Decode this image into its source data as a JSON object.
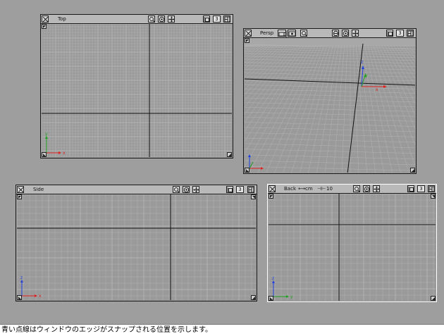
{
  "viewports": {
    "top": {
      "label": "Top",
      "axes": [
        "x",
        "y"
      ],
      "count": "3"
    },
    "persp": {
      "label": "Persp",
      "axes": [
        "x",
        "y",
        "z"
      ],
      "count": "3"
    },
    "side": {
      "label": "Side",
      "axes": [
        "x",
        "z"
      ],
      "count": "3"
    },
    "back": {
      "label": "Back",
      "unit": "cm",
      "step": "10",
      "axes": [
        "y",
        "z"
      ],
      "count": "3"
    }
  },
  "colors": {
    "axis_x": "#e02020",
    "axis_y": "#20a020",
    "axis_z": "#2040e0",
    "grid_line": "#b4b4b4",
    "center_line": "#111111",
    "active_border": "#ffffff"
  },
  "caption": "青い点線はウィンドウのエッジがスナップされる位置を示します。"
}
